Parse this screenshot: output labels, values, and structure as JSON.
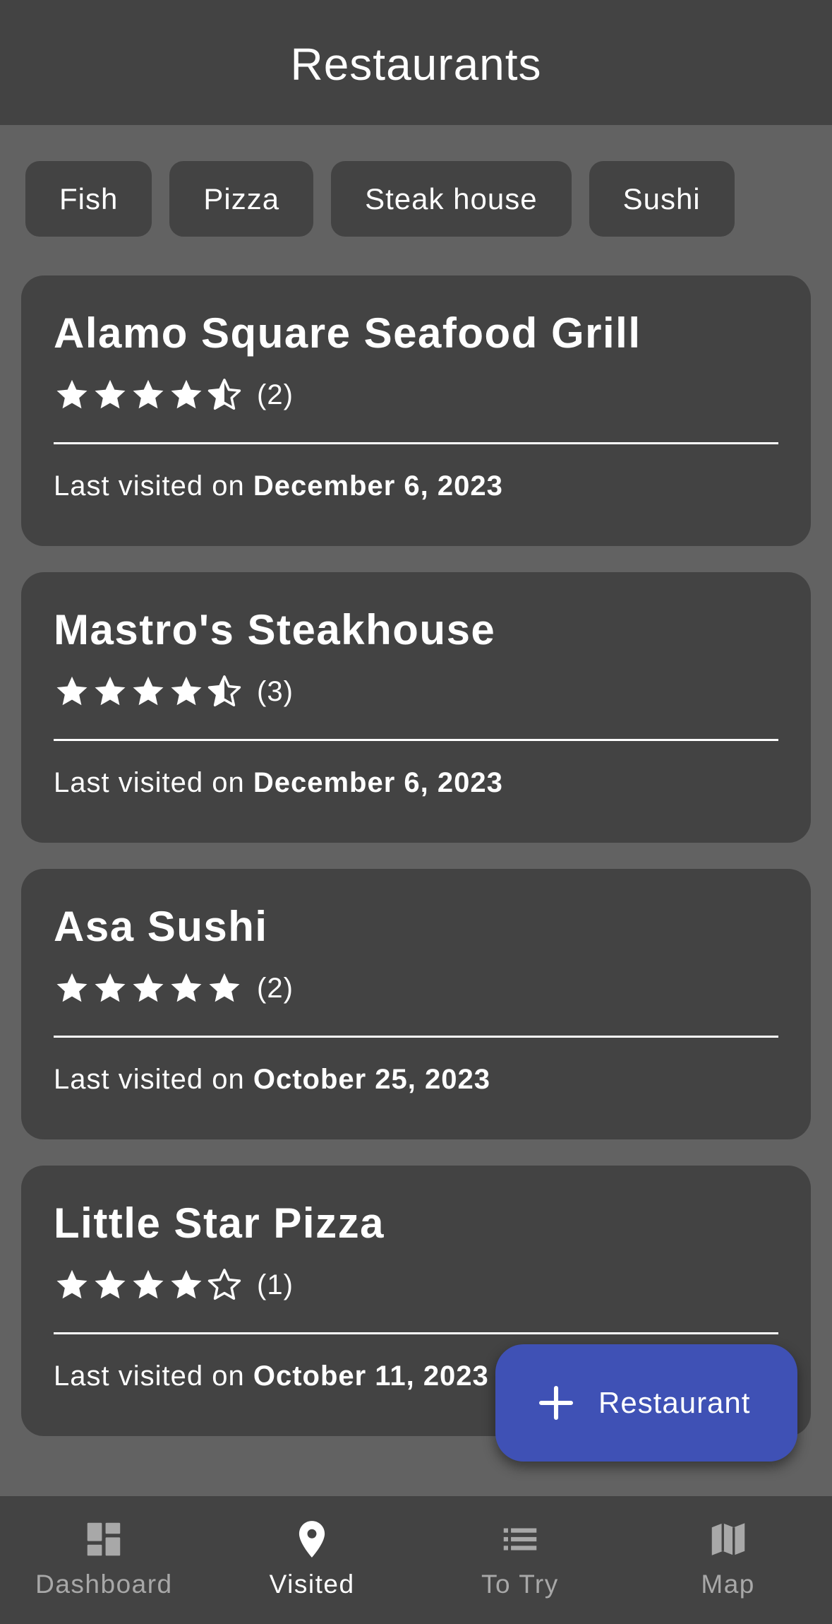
{
  "app_bar": {
    "title": "Restaurants"
  },
  "filters": [
    {
      "label": "Fish"
    },
    {
      "label": "Pizza"
    },
    {
      "label": "Steak house"
    },
    {
      "label": "Sushi"
    }
  ],
  "restaurants": [
    {
      "name": "Alamo Square Seafood Grill",
      "rating": 4.5,
      "review_count": "(2)",
      "visited_prefix": "Last visited on ",
      "visited_date": "December 6, 2023"
    },
    {
      "name": "Mastro's Steakhouse",
      "rating": 4.5,
      "review_count": "(3)",
      "visited_prefix": "Last visited on ",
      "visited_date": "December 6, 2023"
    },
    {
      "name": "Asa Sushi",
      "rating": 5,
      "review_count": "(2)",
      "visited_prefix": "Last visited on ",
      "visited_date": "October 25, 2023"
    },
    {
      "name": "Little Star Pizza",
      "rating": 4,
      "review_count": "(1)",
      "visited_prefix": "Last visited on ",
      "visited_date": "October 11, 2023"
    }
  ],
  "fab": {
    "label": "Restaurant",
    "icon": "plus-icon",
    "color": "#3f51b5"
  },
  "bottom_nav": [
    {
      "label": "Dashboard",
      "icon": "dashboard-icon",
      "active": false
    },
    {
      "label": "Visited",
      "icon": "location-pin-icon",
      "active": true
    },
    {
      "label": "To Try",
      "icon": "list-icon",
      "active": false
    },
    {
      "label": "Map",
      "icon": "map-icon",
      "active": false
    }
  ],
  "colors": {
    "background": "#626262",
    "surface": "#434343",
    "accent": "#3f51b5",
    "inactive_nav": "#a8a8a8"
  }
}
